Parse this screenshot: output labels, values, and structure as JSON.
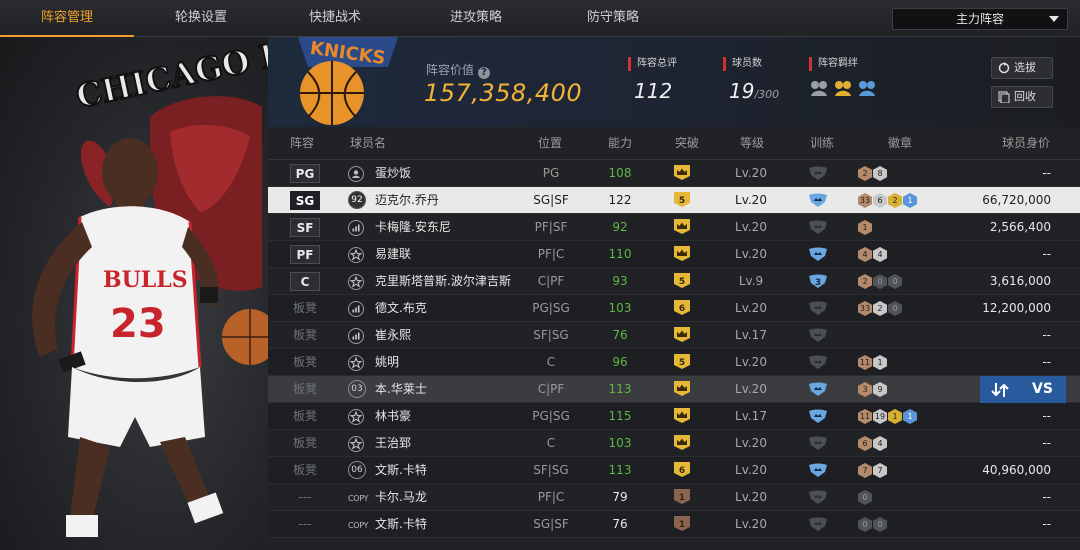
{
  "tabs": [
    {
      "label": "阵容管理",
      "active": true
    },
    {
      "label": "轮换设置",
      "active": false
    },
    {
      "label": "快捷战术",
      "active": false
    },
    {
      "label": "进攻策略",
      "active": false
    },
    {
      "label": "防守策略",
      "active": false
    }
  ],
  "lineup_select": {
    "selected": "主力阵容"
  },
  "art": {
    "team_banner_text": "CHICAGO BULLS",
    "jersey_text": "BULLS",
    "jersey_number": "23",
    "team_logo_text": "KNICKS"
  },
  "header": {
    "value_label": "阵容价值",
    "value": "157,358,400",
    "overall_label": "阵容总评",
    "overall": "112",
    "players_label": "球员数",
    "players_count": "19",
    "players_max": "/300",
    "bond_label": "阵容羁绊",
    "pick_button": "选拔",
    "recycle_button": "回收"
  },
  "columns": {
    "pos": "阵容",
    "name": "球员名",
    "role": "位置",
    "ability": "能力",
    "breakthrough": "突破",
    "level": "等级",
    "training": "训练",
    "badges": "徽章",
    "value": "球员身价"
  },
  "rows": [
    {
      "slot": "PG",
      "icon": "person",
      "name": "蛋炒饭",
      "role": "PG",
      "ability": "108",
      "ability_color": "green",
      "brk": "crown",
      "level": "Lv.20",
      "train": "dim",
      "badges": [
        {
          "t": "2",
          "c": "bronze"
        },
        {
          "t": "8",
          "c": "silver"
        }
      ],
      "value": "--"
    },
    {
      "slot": "SG",
      "icon": "92",
      "name": "迈克尔.乔丹",
      "role": "SG|SF",
      "ability": "122",
      "ability_color": "white",
      "brk": "5",
      "level": "Lv.20",
      "train": "blue",
      "badges": [
        {
          "t": "33",
          "c": "bronze"
        },
        {
          "t": "6",
          "c": "silver"
        },
        {
          "t": "2",
          "c": "gold"
        },
        {
          "t": "1",
          "c": "blue"
        }
      ],
      "value": "66,720,000",
      "selected": true
    },
    {
      "slot": "SF",
      "icon": "bars",
      "name": "卡梅隆.安东尼",
      "role": "PF|SF",
      "ability": "92",
      "ability_color": "green",
      "brk": "crown",
      "level": "Lv.20",
      "train": "dim",
      "badges": [
        {
          "t": "1",
          "c": "bronze"
        }
      ],
      "value": "2,566,400"
    },
    {
      "slot": "PF",
      "icon": "star",
      "name": "易建联",
      "role": "PF|C",
      "ability": "110",
      "ability_color": "green",
      "brk": "crown",
      "level": "Lv.20",
      "train": "blue",
      "badges": [
        {
          "t": "4",
          "c": "bronze"
        },
        {
          "t": "4",
          "c": "silver"
        }
      ],
      "value": "--"
    },
    {
      "slot": "C",
      "icon": "star",
      "name": "克里斯塔普斯.波尔津吉斯",
      "role": "C|PF",
      "ability": "93",
      "ability_color": "green",
      "brk": "5",
      "level": "Lv.9",
      "train": "blue3",
      "badges": [
        {
          "t": "2",
          "c": "bronze"
        },
        {
          "t": "0",
          "c": "dark"
        },
        {
          "t": "0",
          "c": "dark"
        }
      ],
      "value": "3,616,000"
    },
    {
      "slot": "板凳",
      "icon": "bars",
      "name": "德文.布克",
      "role": "PG|SG",
      "ability": "103",
      "ability_color": "green",
      "brk": "6",
      "level": "Lv.20",
      "train": "dim",
      "badges": [
        {
          "t": "33",
          "c": "bronze"
        },
        {
          "t": "2",
          "c": "silver"
        },
        {
          "t": "0",
          "c": "dark"
        }
      ],
      "value": "12,200,000"
    },
    {
      "slot": "板凳",
      "icon": "bars",
      "name": "崔永熙",
      "role": "SF|SG",
      "ability": "76",
      "ability_color": "green",
      "brk": "crown",
      "level": "Lv.17",
      "train": "dim",
      "badges": [],
      "value": "--"
    },
    {
      "slot": "板凳",
      "icon": "star",
      "name": "姚明",
      "role": "C",
      "ability": "96",
      "ability_color": "green",
      "brk": "5",
      "level": "Lv.20",
      "train": "dim",
      "badges": [
        {
          "t": "11",
          "c": "bronze"
        },
        {
          "t": "1",
          "c": "silver"
        }
      ],
      "value": "--"
    },
    {
      "slot": "板凳",
      "icon": "03",
      "name": "本.华莱士",
      "role": "C|PF",
      "ability": "113",
      "ability_color": "green",
      "brk": "crown",
      "level": "Lv.20",
      "train": "blue",
      "badges": [
        {
          "t": "3",
          "c": "bronze"
        },
        {
          "t": "9",
          "c": "silver"
        }
      ],
      "value": "--",
      "highlight": true
    },
    {
      "slot": "板凳",
      "icon": "star",
      "name": "林书豪",
      "role": "PG|SG",
      "ability": "115",
      "ability_color": "green",
      "brk": "crown",
      "level": "Lv.17",
      "train": "blue",
      "badges": [
        {
          "t": "11",
          "c": "bronze"
        },
        {
          "t": "19",
          "c": "silver"
        },
        {
          "t": "1",
          "c": "gold"
        },
        {
          "t": "1",
          "c": "blue"
        }
      ],
      "value": "--"
    },
    {
      "slot": "板凳",
      "icon": "star",
      "name": "王治郅",
      "role": "C",
      "ability": "103",
      "ability_color": "green",
      "brk": "crown",
      "level": "Lv.20",
      "train": "dim",
      "badges": [
        {
          "t": "6",
          "c": "bronze"
        },
        {
          "t": "4",
          "c": "silver"
        }
      ],
      "value": "--"
    },
    {
      "slot": "板凳",
      "icon": "06",
      "name": "文斯.卡特",
      "role": "SF|SG",
      "ability": "113",
      "ability_color": "green",
      "brk": "6",
      "level": "Lv.20",
      "train": "blue",
      "badges": [
        {
          "t": "7",
          "c": "bronze"
        },
        {
          "t": "7",
          "c": "silver"
        }
      ],
      "value": "40,960,000"
    },
    {
      "slot": "---",
      "icon": "copy",
      "name": "卡尔.马龙",
      "role": "PF|C",
      "ability": "79",
      "ability_color": "white",
      "brk": "1",
      "level": "Lv.20",
      "train": "dim",
      "badges": [
        {
          "t": "0",
          "c": "dark"
        }
      ],
      "value": "--"
    },
    {
      "slot": "---",
      "icon": "copy",
      "name": "文斯.卡特",
      "role": "SG|SF",
      "ability": "76",
      "ability_color": "white",
      "brk": "1",
      "level": "Lv.20",
      "train": "dim",
      "badges": [
        {
          "t": "0",
          "c": "dark"
        },
        {
          "t": "0",
          "c": "dark"
        }
      ],
      "value": "--"
    }
  ],
  "swap_button": {
    "label": "VS"
  },
  "copy_label": "COPY"
}
